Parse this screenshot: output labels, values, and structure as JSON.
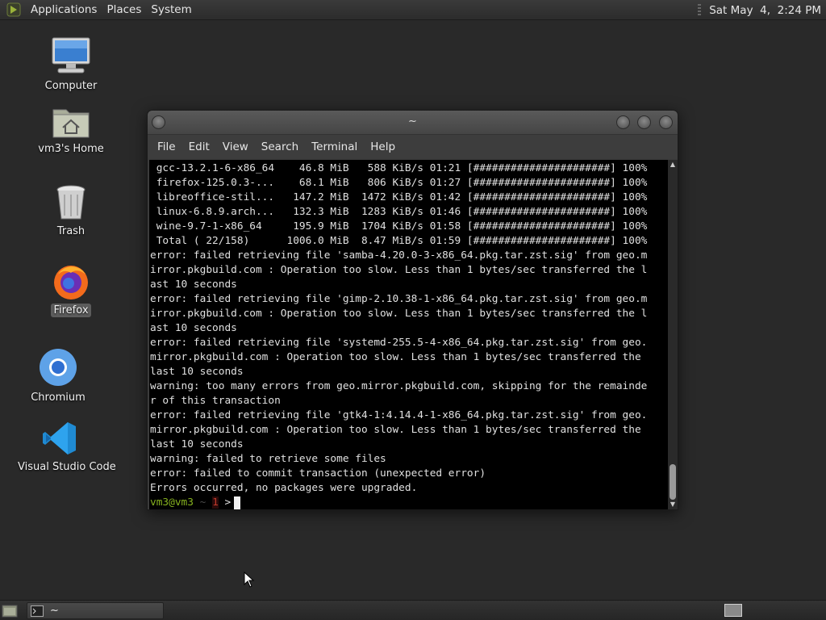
{
  "top_panel": {
    "menus": [
      "Applications",
      "Places",
      "System"
    ],
    "clock": "Sat May  4,  2:24 PM"
  },
  "desktop": {
    "icons": [
      {
        "label": "Computer",
        "icon": "computer-icon"
      },
      {
        "label": "vm3's Home",
        "icon": "home-folder-icon"
      },
      {
        "label": "Trash",
        "icon": "trash-icon"
      },
      {
        "label": "Firefox",
        "icon": "firefox-icon",
        "selected": true
      },
      {
        "label": "Chromium",
        "icon": "chromium-icon"
      },
      {
        "label": "Visual Studio Code",
        "icon": "vscode-icon"
      }
    ]
  },
  "terminal": {
    "title": "~",
    "menu": [
      "File",
      "Edit",
      "View",
      "Search",
      "Terminal",
      "Help"
    ],
    "lines": [
      " gcc-13.2.1-6-x86_64    46.8 MiB   588 KiB/s 01:21 [######################] 100%",
      " firefox-125.0.3-...    68.1 MiB   806 KiB/s 01:27 [######################] 100%",
      " libreoffice-stil...   147.2 MiB  1472 KiB/s 01:42 [######################] 100%",
      " linux-6.8.9.arch...   132.3 MiB  1283 KiB/s 01:46 [######################] 100%",
      " wine-9.7-1-x86_64     195.9 MiB  1704 KiB/s 01:58 [######################] 100%",
      " Total ( 22/158)      1006.0 MiB  8.47 MiB/s 01:59 [######################] 100%",
      "error: failed retrieving file 'samba-4.20.0-3-x86_64.pkg.tar.zst.sig' from geo.m",
      "irror.pkgbuild.com : Operation too slow. Less than 1 bytes/sec transferred the l",
      "ast 10 seconds",
      "error: failed retrieving file 'gimp-2.10.38-1-x86_64.pkg.tar.zst.sig' from geo.m",
      "irror.pkgbuild.com : Operation too slow. Less than 1 bytes/sec transferred the l",
      "ast 10 seconds",
      "error: failed retrieving file 'systemd-255.5-4-x86_64.pkg.tar.zst.sig' from geo.",
      "mirror.pkgbuild.com : Operation too slow. Less than 1 bytes/sec transferred the",
      "last 10 seconds",
      "warning: too many errors from geo.mirror.pkgbuild.com, skipping for the remainde",
      "r of this transaction",
      "error: failed retrieving file 'gtk4-1:4.14.4-1-x86_64.pkg.tar.zst.sig' from geo.",
      "mirror.pkgbuild.com : Operation too slow. Less than 1 bytes/sec transferred the",
      "last 10 seconds",
      "warning: failed to retrieve some files",
      "error: failed to commit transaction (unexpected error)",
      "Errors occurred, no packages were upgraded."
    ],
    "prompt": {
      "user": "vm3@vm3",
      "tilde": "~",
      "status": "1",
      "arrow": ">"
    }
  },
  "taskbar": {
    "task_label": "~"
  }
}
